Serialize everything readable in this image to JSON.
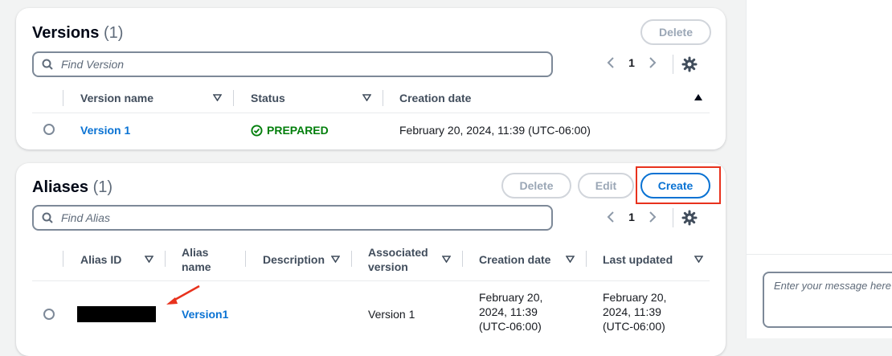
{
  "versions": {
    "title": "Versions",
    "count": "(1)",
    "delete_label": "Delete",
    "search_placeholder": "Find Version",
    "page": "1",
    "columns": [
      "Version name",
      "Status",
      "Creation date"
    ],
    "rows": [
      {
        "name": "Version 1",
        "status": "PREPARED",
        "creation_date": "February 20, 2024, 11:39 (UTC-06:00)"
      }
    ]
  },
  "aliases": {
    "title": "Aliases",
    "count": "(1)",
    "delete_label": "Delete",
    "edit_label": "Edit",
    "create_label": "Create",
    "search_placeholder": "Find Alias",
    "page": "1",
    "columns": [
      "Alias ID",
      "Alias name",
      "Description",
      "Associated version",
      "Creation date",
      "Last updated"
    ],
    "rows": [
      {
        "alias_name": "Version1",
        "associated_version": "Version 1",
        "creation_date": "February 20, 2024, 11:39 (UTC-06:00)",
        "last_updated": "February 20, 2024, 11:39 (UTC-06:00)"
      }
    ]
  },
  "chat": {
    "placeholder": "Enter your message here"
  },
  "colors": {
    "accent": "#0972d3",
    "success": "#037f0c",
    "highlight": "#e8321d"
  }
}
